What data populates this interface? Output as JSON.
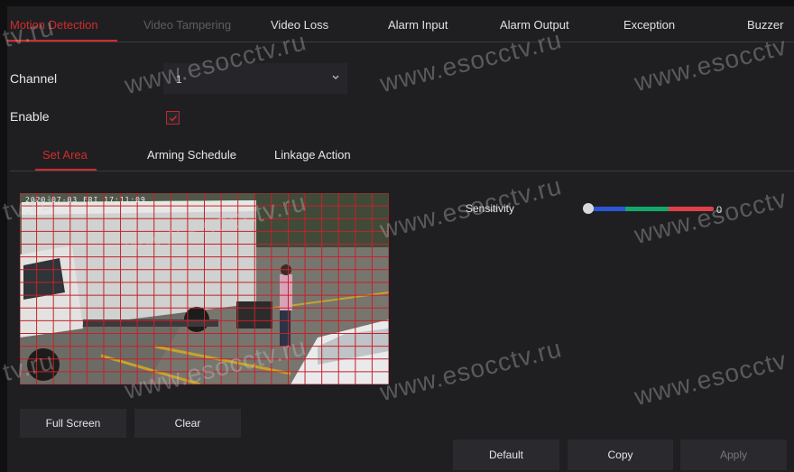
{
  "top_tabs": [
    {
      "label": "Motion Detection",
      "state": "active"
    },
    {
      "label": "Video Tampering",
      "state": "disabled"
    },
    {
      "label": "Video Loss",
      "state": "normal"
    },
    {
      "label": "Alarm Input",
      "state": "normal"
    },
    {
      "label": "Alarm Output",
      "state": "normal"
    },
    {
      "label": "Exception",
      "state": "normal"
    },
    {
      "label": "Buzzer",
      "state": "normal"
    }
  ],
  "form": {
    "channel_label": "Channel",
    "channel_value": "1",
    "enable_label": "Enable",
    "enable_checked": true
  },
  "sub_tabs": [
    {
      "label": "Set Area",
      "state": "active"
    },
    {
      "label": "Arming Schedule",
      "state": "normal"
    },
    {
      "label": "Linkage Action",
      "state": "normal"
    }
  ],
  "camera": {
    "osd_timestamp": "2020-07-03 FRI 17:11:09",
    "grid_cols": 22,
    "grid_rows": 15
  },
  "sensitivity": {
    "label": "Sensitivity",
    "value": "0",
    "level_fraction": 0
  },
  "buttons": {
    "full_screen": "Full Screen",
    "clear": "Clear",
    "default": "Default",
    "copy": "Copy",
    "apply": "Apply"
  },
  "watermarks": [
    "www.esocctv.ru",
    "www.esocctv.ru",
    "www.esocctv",
    "www.esocctv.ru",
    "www.esocctv",
    "tv.ru",
    "www.esocctv.ru",
    "www.esocctv.ru",
    "www.esocctv",
    "tv.ru",
    "tv.ru",
    "www.esocctv.ru"
  ],
  "colors": {
    "accent": "#d12c2c",
    "panel": "#1f1f22",
    "control": "#2a2a2e",
    "slider_blue": "#2a55d6",
    "slider_green": "#13a86a",
    "slider_red": "#e0404a"
  }
}
